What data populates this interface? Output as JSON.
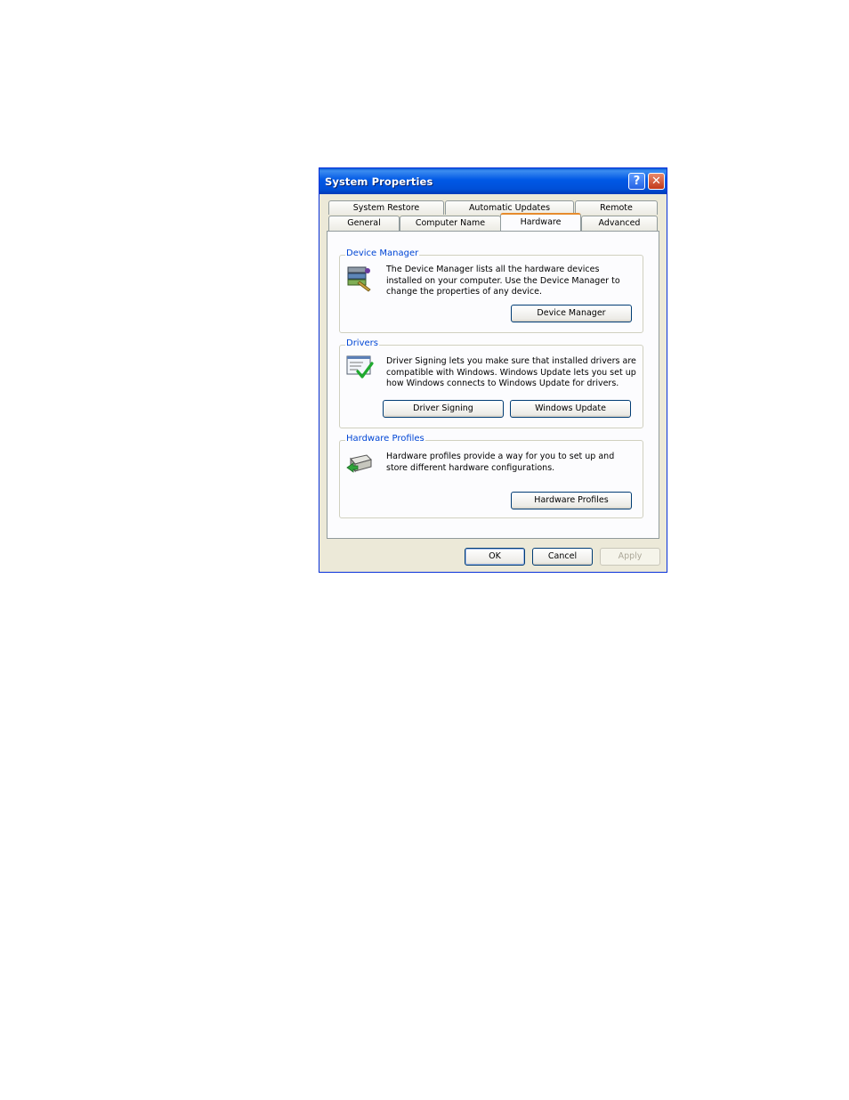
{
  "dialog": {
    "title": "System Properties",
    "help_label": "?",
    "close_label": "✕"
  },
  "tabs": {
    "row1": [
      "System Restore",
      "Automatic Updates",
      "Remote"
    ],
    "row2": [
      "General",
      "Computer Name",
      "Hardware",
      "Advanced"
    ],
    "active": "Hardware"
  },
  "device_manager": {
    "legend": "Device Manager",
    "description": "The Device Manager lists all the hardware devices installed on your computer. Use the Device Manager to change the properties of any device.",
    "button": "Device Manager",
    "icon": "device-manager-icon"
  },
  "drivers": {
    "legend": "Drivers",
    "description": "Driver Signing lets you make sure that installed drivers are compatible with Windows. Windows Update lets you set up how Windows connects to Windows Update for drivers.",
    "signing_button": "Driver Signing",
    "update_button": "Windows Update",
    "icon": "driver-signing-icon"
  },
  "hardware_profiles": {
    "legend": "Hardware Profiles",
    "description": "Hardware profiles provide a way for you to set up and store different hardware configurations.",
    "button": "Hardware Profiles",
    "icon": "hardware-profiles-icon"
  },
  "footer": {
    "ok": "OK",
    "cancel": "Cancel",
    "apply": "Apply"
  },
  "colors": {
    "titlebar": "#0058e6",
    "dialog_bg": "#ece9d8",
    "legend_text": "#0046d5",
    "active_tab_accent": "#e68b2c"
  }
}
